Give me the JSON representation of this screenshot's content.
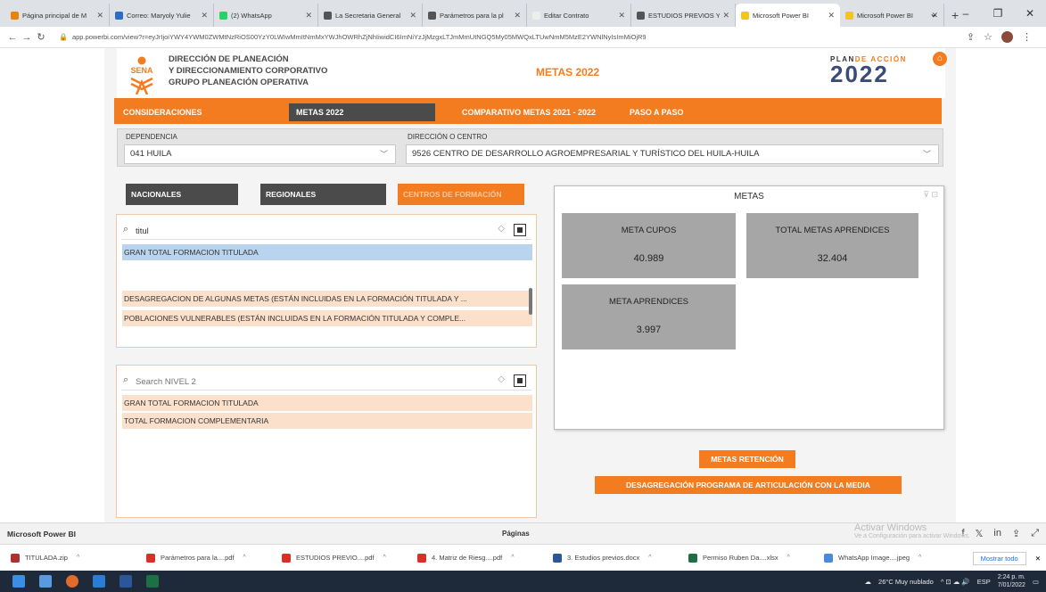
{
  "browser": {
    "tabs": [
      {
        "label": "Página principal de M",
        "color": "#e8830c"
      },
      {
        "label": "Correo: Maryoly Yulie",
        "color": "#2b6cc4"
      },
      {
        "label": "(2) WhatsApp",
        "color": "#25d366"
      },
      {
        "label": "La Secretaria General",
        "color": "#555555"
      },
      {
        "label": "Parámetros para la pl",
        "color": "#555555"
      },
      {
        "label": "Editar Contrato",
        "color": "#eeeeee"
      },
      {
        "label": "ESTUDIOS PREVIOS Y",
        "color": "#555555"
      },
      {
        "label": "Microsoft Power BI",
        "color": "#f2c811"
      },
      {
        "label": "Microsoft Power BI",
        "color": "#f2c811"
      }
    ],
    "new_tab": "+",
    "url": "app.powerbi.com/view?r=eyJrIjoiYWY4YWM0ZWMtNzRiOS00YzY0LWIwMmItNmMxYWJhOWRhZjNhIiwidCI6ImNiYzJjMzgxLTJmMmUtNGQ5My05MWQxLTUwNmM5MzE2YWNlNyIsImMiOjR9"
  },
  "report": {
    "header": {
      "org_lines": [
        "DIRECCIÓN DE PLANEACIÓN",
        "Y DIRECCIONAMIENTO CORPORATIVO",
        "GRUPO PLANEACIÓN OPERATIVA"
      ],
      "page_title": "METAS 2022",
      "plan_label_a": "PLAN",
      "plan_label_b": "DE ACCIÓN",
      "plan_year": "2022",
      "sena_logo_text": "SENA"
    },
    "nav": [
      {
        "label": "CONSIDERACIONES"
      },
      {
        "label": "METAS 2022"
      },
      {
        "label": "COMPARATIVO METAS 2021 - 2022"
      },
      {
        "label": "PASO A PASO"
      }
    ],
    "filters": {
      "dependencia_label": "DEPENDENCIA",
      "dependencia_value": "041 HUILA",
      "centro_label": "DIRECCIÓN O CENTRO",
      "centro_value": "9526 CENTRO DE DESARROLLO AGROEMPRESARIAL Y TURÍSTICO DEL HUILA-HUILA"
    },
    "scope_buttons": [
      {
        "label": "NACIONALES"
      },
      {
        "label": "REGIONALES"
      },
      {
        "label": "CENTROS DE FORMACIÓN"
      }
    ],
    "slicer1": {
      "search_value": "titul",
      "items": [
        "GRAN TOTAL FORMACION TITULADA",
        "DESAGREGACION DE ALGUNAS METAS (ESTÁN INCLUIDAS EN LA FORMACIÓN TITULADA Y ...",
        "POBLACIONES VULNERABLES (ESTÁN INCLUIDAS EN LA FORMACIÓN TITULADA Y COMPLE..."
      ]
    },
    "slicer2": {
      "search_placeholder": "Search NIVEL 2",
      "items": [
        "GRAN TOTAL FORMACION TITULADA",
        "TOTAL FORMACION COMPLEMENTARIA"
      ]
    },
    "metas": {
      "title": "METAS",
      "kpis": [
        {
          "label": "META CUPOS",
          "value": "40.989"
        },
        {
          "label": "TOTAL METAS APRENDICES",
          "value": "32.404"
        },
        {
          "label": "META APRENDICES",
          "value": "3.997"
        }
      ]
    },
    "buttons": {
      "retencion": "METAS RETENCIÓN",
      "articulacion": "DESAGREGACIÓN PROGRAMA DE ARTICULACIÓN CON LA MEDIA"
    }
  },
  "watermark": {
    "line1": "Activar Windows",
    "line2": "Ve a Configuración para activar Windows."
  },
  "pbi_footer": {
    "brand": "Microsoft Power BI",
    "pages_label": "Páginas"
  },
  "downloads": {
    "items": [
      {
        "name": "TITULADA.zip",
        "color": "#b03030"
      },
      {
        "name": "Parámetros para la....pdf",
        "color": "#d93025"
      },
      {
        "name": "ESTUDIOS PREVIO....pdf",
        "color": "#d93025"
      },
      {
        "name": "4. Matriz de Riesg....pdf",
        "color": "#d93025"
      },
      {
        "name": "3. Estudios previos.docx",
        "color": "#2b5797"
      },
      {
        "name": "Permiso Ruben Da....xlsx",
        "color": "#1d7044"
      },
      {
        "name": "WhatsApp Image....jpeg",
        "color": "#4a89dc"
      }
    ],
    "show_all": "Mostrar todo"
  },
  "taskbar": {
    "weather": "26°C Muy nublado",
    "lang": "ESP",
    "time": "2:24 p. m.",
    "date": "7/01/2022"
  },
  "colors": {
    "accent": "#f47c20",
    "dark_button": "#4b4b4b",
    "kpi_bg": "#a6a6a6"
  }
}
